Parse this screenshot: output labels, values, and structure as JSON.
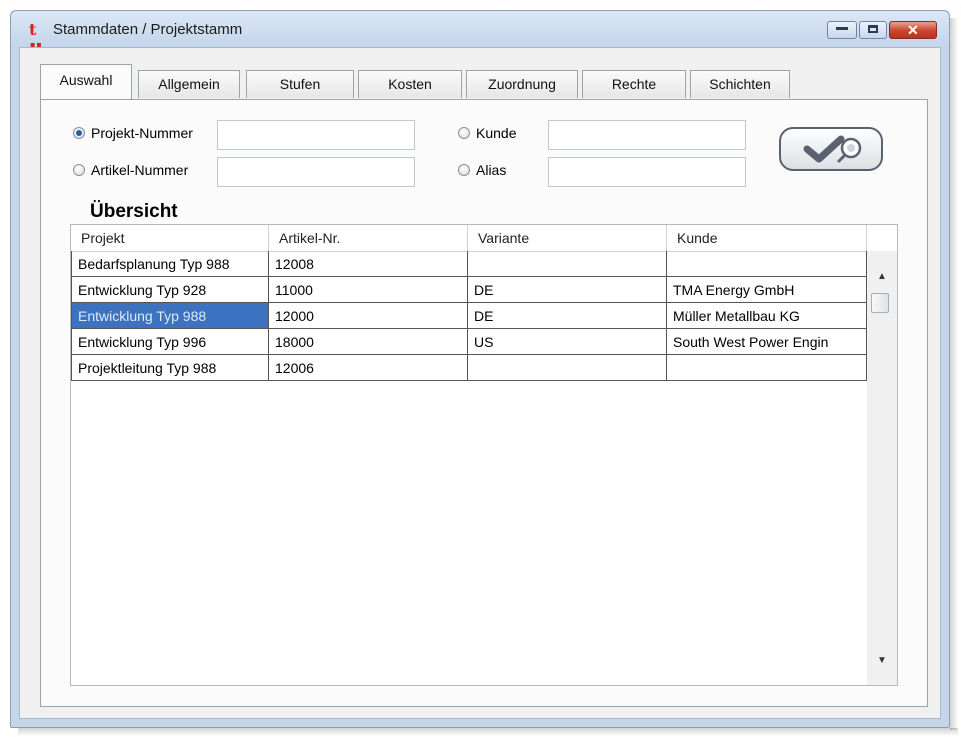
{
  "window": {
    "title": "Stammdaten / Projektstamm",
    "close_glyph": "✕"
  },
  "tabs": [
    {
      "label": "Auswahl",
      "active": true
    },
    {
      "label": "Allgemein"
    },
    {
      "label": "Stufen"
    },
    {
      "label": "Kosten"
    },
    {
      "label": "Zuordnung"
    },
    {
      "label": "Rechte"
    },
    {
      "label": "Schichten"
    }
  ],
  "search": {
    "options": [
      {
        "label": "Projekt-Nummer",
        "checked": true,
        "value": ""
      },
      {
        "label": "Artikel-Nummer",
        "checked": false,
        "value": ""
      },
      {
        "label": "Kunde",
        "checked": false,
        "value": ""
      },
      {
        "label": "Alias",
        "checked": false,
        "value": ""
      }
    ],
    "button_icon": "check-magnifier-icon"
  },
  "overview": {
    "title": "Übersicht",
    "columns": [
      "Projekt",
      "Artikel-Nr.",
      "Variante",
      "Kunde"
    ],
    "rows": [
      [
        "Bedarfsplanung Typ 988",
        "12008",
        "",
        ""
      ],
      [
        "Entwicklung Typ 928",
        "11000",
        "DE",
        "TMA Energy GmbH"
      ],
      [
        "Entwicklung Typ 988",
        "12000",
        "DE",
        "Müller Metallbau KG"
      ],
      [
        "Entwicklung Typ 996",
        "18000",
        "US",
        "South West Power Engin"
      ],
      [
        "Projektleitung Typ 988",
        "12006",
        "",
        ""
      ]
    ],
    "selected_row": 2,
    "scroll_up": "▲",
    "scroll_down": "▼"
  },
  "colors": {
    "selection": "#3d72c0",
    "close_button": "#c9452e",
    "app_icon": "#d0261c"
  }
}
